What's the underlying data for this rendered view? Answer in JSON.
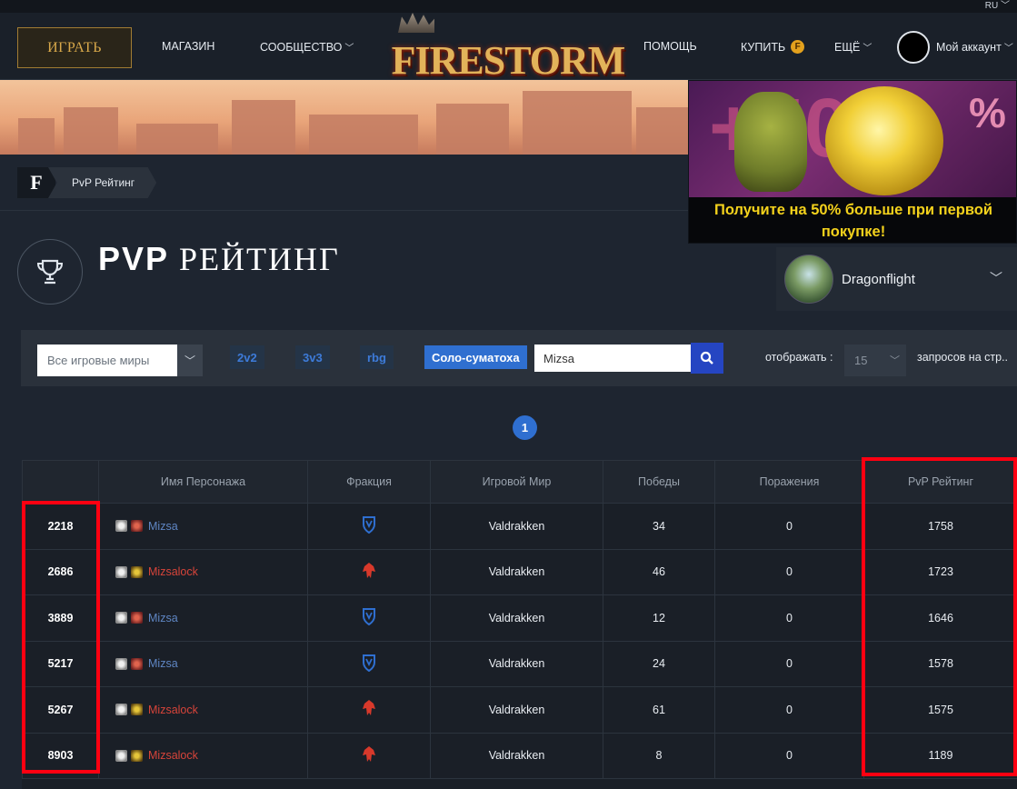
{
  "top_bar": {
    "lang": "RU ﹀"
  },
  "header": {
    "play_label": "ИГРАТЬ",
    "nav": {
      "shop": "МАГАЗИН",
      "community": "СООБЩЕСТВО",
      "help": "ПОМОЩЬ",
      "buy": "КУПИТЬ",
      "more": "ЕЩЁ",
      "account": "Мой аккаунт"
    },
    "logo_text": "FIRESTORM",
    "coin_letter": "F"
  },
  "promo": {
    "percent": "+50",
    "percent_sign": "%",
    "text": "Получите на 50% больше при первой покупке!"
  },
  "breadcrumb": {
    "logo": "F",
    "current": "PvP Рейтинг"
  },
  "title": {
    "bold": "PVP",
    "rest": "РЕЙТИНГ"
  },
  "expansion": {
    "name": "Dragonflight"
  },
  "filters": {
    "realm_placeholder": "Все игровые миры",
    "brackets": [
      "2v2",
      "3v3",
      "rbg",
      "Соло-суматоха"
    ],
    "active_bracket": "Соло-суматоха",
    "search_value": "Mizsa",
    "show_label": "отображать :",
    "per_page": "15",
    "per_page_suffix": "запросов на стр.."
  },
  "pagination": {
    "current": "1"
  },
  "table": {
    "headers": [
      "",
      "Имя Персонажа",
      "Фракция",
      "Игровой Мир",
      "Победы",
      "Поражения",
      "PvP Рейтинг"
    ],
    "rows": [
      {
        "rank": "2218",
        "name": "Mizsa",
        "faction": "alliance",
        "realm": "Valdrakken",
        "wins": "34",
        "losses": "0",
        "rating": "1758"
      },
      {
        "rank": "2686",
        "name": "Mizsalock",
        "faction": "horde",
        "realm": "Valdrakken",
        "wins": "46",
        "losses": "0",
        "rating": "1723"
      },
      {
        "rank": "3889",
        "name": "Mizsa",
        "faction": "alliance",
        "realm": "Valdrakken",
        "wins": "12",
        "losses": "0",
        "rating": "1646"
      },
      {
        "rank": "5217",
        "name": "Mizsa",
        "faction": "alliance",
        "realm": "Valdrakken",
        "wins": "24",
        "losses": "0",
        "rating": "1578"
      },
      {
        "rank": "5267",
        "name": "Mizsalock",
        "faction": "horde",
        "realm": "Valdrakken",
        "wins": "61",
        "losses": "0",
        "rating": "1575"
      },
      {
        "rank": "8903",
        "name": "Mizsalock",
        "faction": "horde",
        "realm": "Valdrakken",
        "wins": "8",
        "losses": "0",
        "rating": "1189"
      }
    ]
  },
  "colors": {
    "alliance": "#2f6fd0",
    "horde": "#d8392b",
    "alliance_name": "#5f86c4",
    "horde_name": "#d7443a",
    "highlight": "#ff0011",
    "accent_gold": "#d8a84a"
  },
  "icons": {
    "chevron": "chevron-down-icon",
    "trophy": "trophy-icon",
    "search": "search-icon",
    "alliance": "alliance-crest-icon",
    "horde": "horde-crest-icon"
  }
}
